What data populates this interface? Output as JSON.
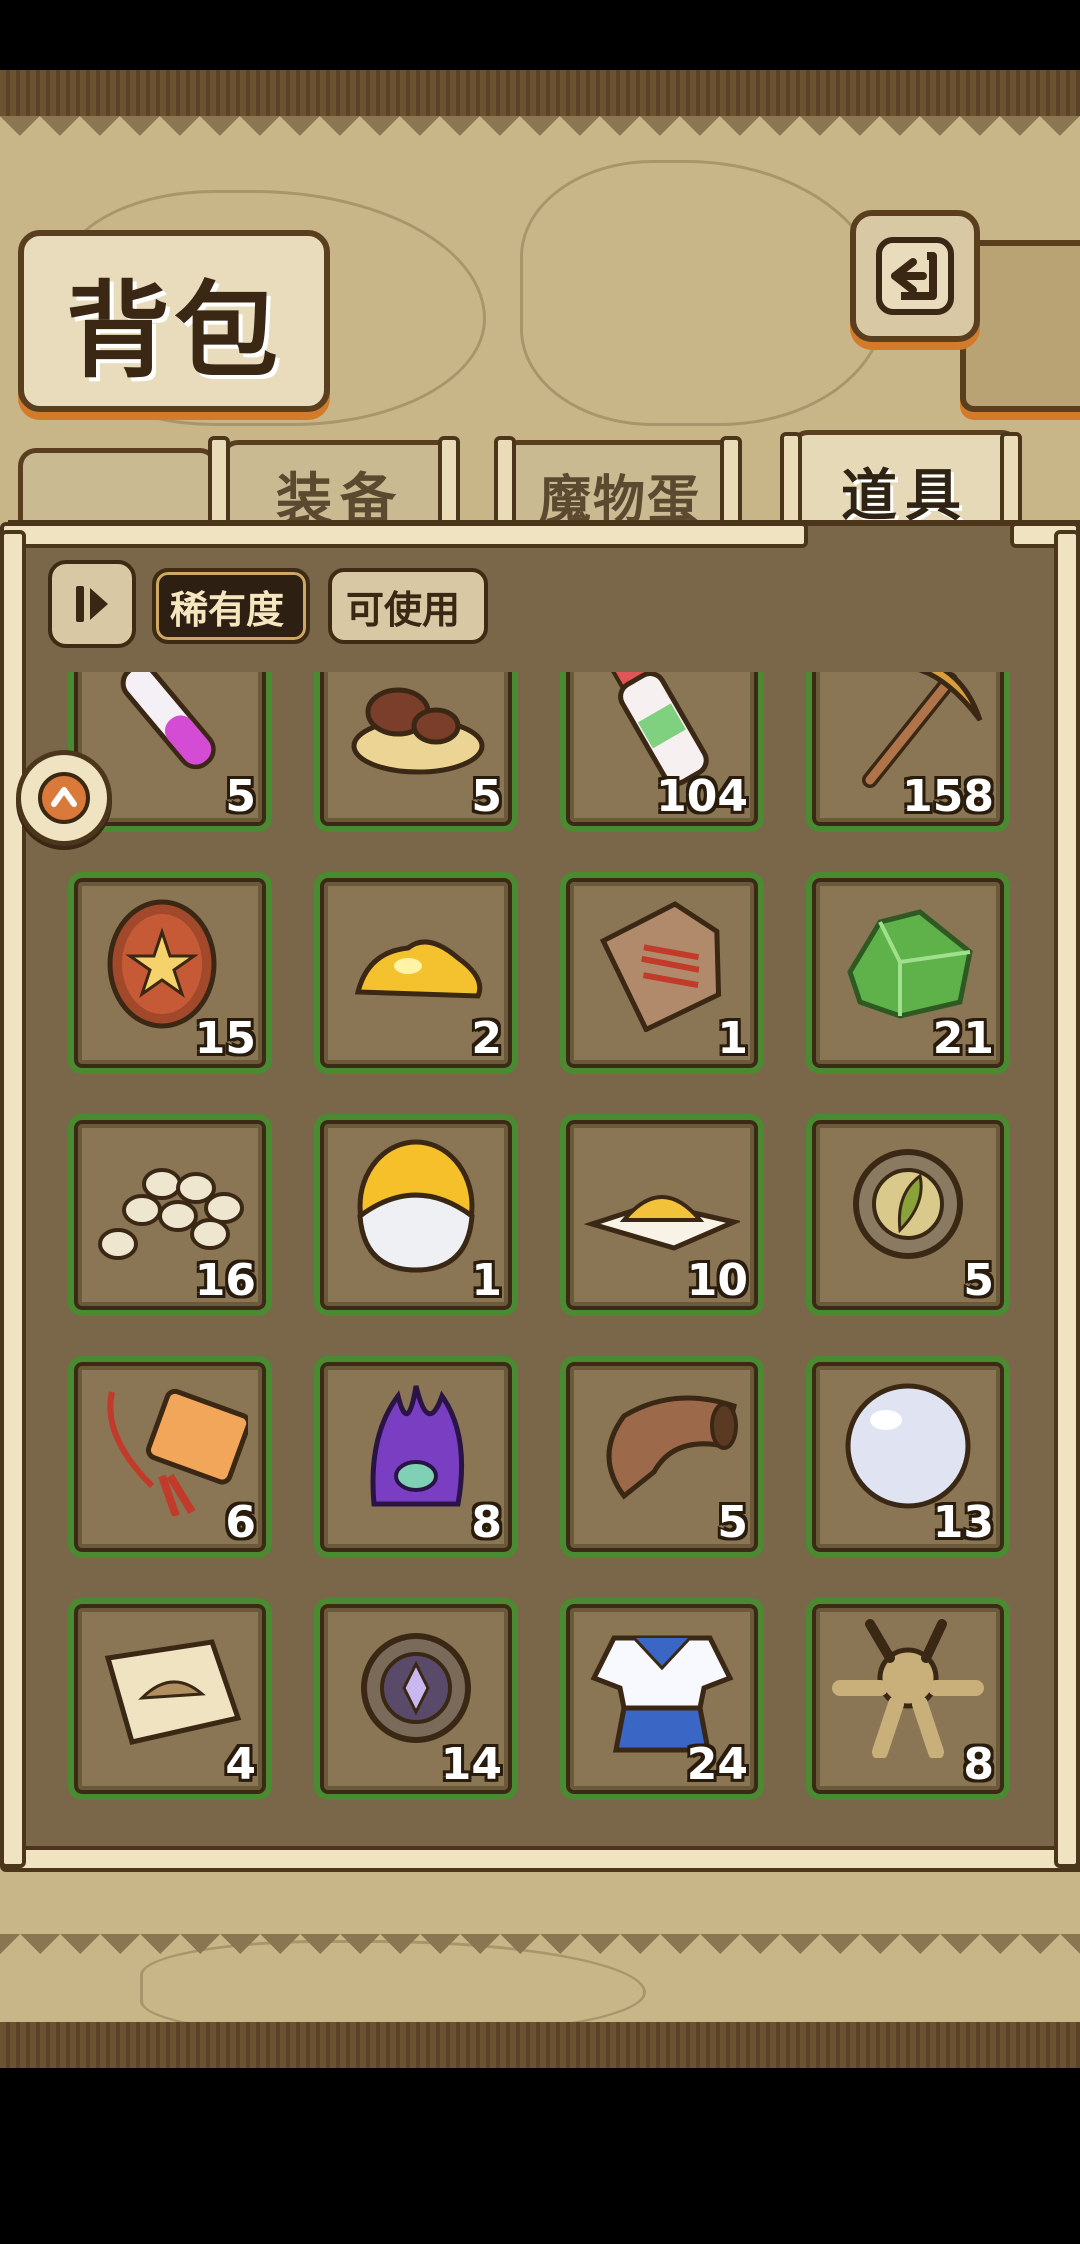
{
  "header": {
    "title": "背包"
  },
  "tabs": [
    {
      "label": "装备",
      "active": false
    },
    {
      "label": "魔物蛋",
      "active": false
    },
    {
      "label": "道具",
      "active": true
    }
  ],
  "filters": {
    "rarity": "稀有度",
    "usable": "可使用"
  },
  "items": [
    {
      "icon": "test-tube-icon",
      "qty": "5"
    },
    {
      "icon": "mushroom-icon",
      "qty": "5"
    },
    {
      "icon": "potion-bottle-icon",
      "qty": "104"
    },
    {
      "icon": "pickaxe-icon",
      "qty": "158"
    },
    {
      "icon": "star-coin-icon",
      "qty": "15"
    },
    {
      "icon": "gold-pile-icon",
      "qty": "2"
    },
    {
      "icon": "wooden-tag-icon",
      "qty": "1"
    },
    {
      "icon": "green-crystal-icon",
      "qty": "21"
    },
    {
      "icon": "seeds-icon",
      "qty": "16"
    },
    {
      "icon": "egg-icon",
      "qty": "1"
    },
    {
      "icon": "powder-icon",
      "qty": "10"
    },
    {
      "icon": "leaf-medallion-icon",
      "qty": "5"
    },
    {
      "icon": "charm-tag-icon",
      "qty": "6"
    },
    {
      "icon": "purple-monster-icon",
      "qty": "8"
    },
    {
      "icon": "horn-icon",
      "qty": "5"
    },
    {
      "icon": "pearl-icon",
      "qty": "13"
    },
    {
      "icon": "treasure-map-icon",
      "qty": "4"
    },
    {
      "icon": "rune-medallion-icon",
      "qty": "14"
    },
    {
      "icon": "uniform-icon",
      "qty": "24"
    },
    {
      "icon": "voodoo-doll-icon",
      "qty": "8"
    }
  ]
}
